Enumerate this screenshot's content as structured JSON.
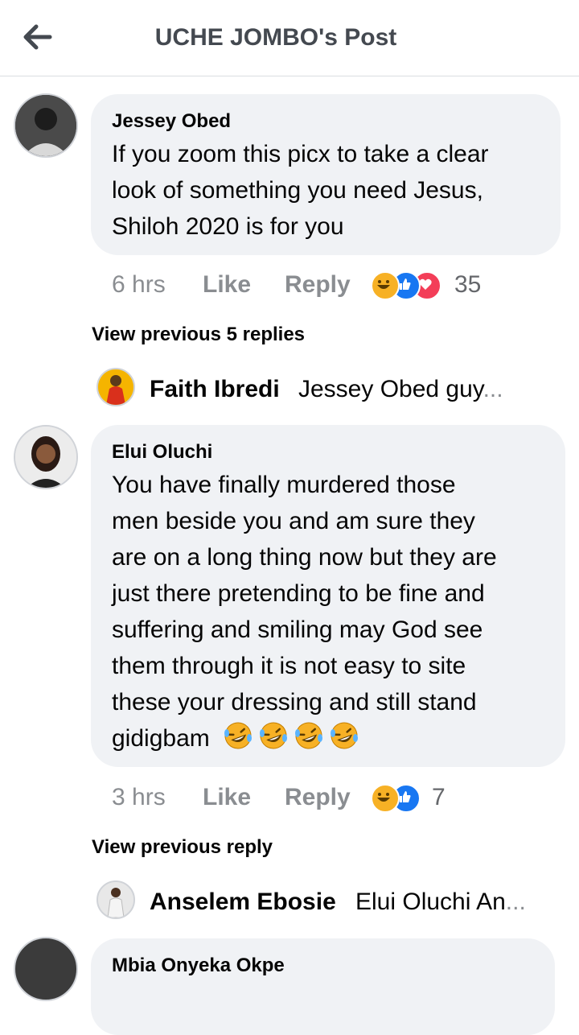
{
  "header": {
    "title": "UCHE JOMBO's Post",
    "back_icon": "arrow-left-icon"
  },
  "comments": [
    {
      "author": "Jessey Obed",
      "lines": [
        "If you zoom this picx to take a clear",
        "look of something you need  Jesus,",
        "Shiloh 2020 is for you"
      ],
      "time": "6 hrs",
      "like_label": "Like",
      "reply_label": "Reply",
      "reactions": [
        "haha",
        "like",
        "love"
      ],
      "reaction_count": "35",
      "view_previous": "View previous 5 replies",
      "latest_reply": {
        "author": "Faith Ibredi",
        "preview": "Jessey Obed guy",
        "ellipsis": "..."
      }
    },
    {
      "author": "Elui Oluchi",
      "lines": [
        "You have finally murdered those",
        "men beside you and am sure they",
        "are on a long thing now but they are",
        "just there pretending to be fine and",
        "suffering and smiling may God see",
        "them through it is not easy to site",
        "these your dressing and still stand",
        "gidigbam"
      ],
      "emoji_count": 4,
      "time": "3 hrs",
      "like_label": "Like",
      "reply_label": "Reply",
      "reactions": [
        "haha",
        "like"
      ],
      "reaction_count": "7",
      "view_previous": "View previous reply",
      "latest_reply": {
        "author": "Anselem Ebosie",
        "preview": "Elui Oluchi An",
        "ellipsis": "..."
      }
    },
    {
      "author": "Mbia Onyeka Okpe"
    }
  ],
  "colors": {
    "like": "#1877f2",
    "love": "#f33e58",
    "haha": "#f7b125",
    "bubble": "#f0f2f5",
    "meta": "#8a8d91"
  }
}
